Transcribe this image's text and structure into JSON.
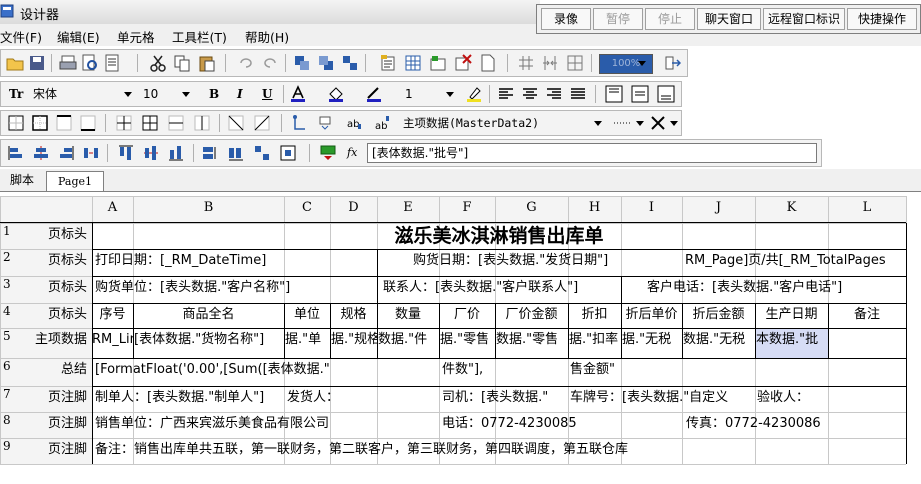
{
  "window": {
    "title": "设计器"
  },
  "menu": [
    "文件(F)",
    "编辑(E)",
    "单元格",
    "工具栏(T)",
    "帮助(H)"
  ],
  "float_toolbar": [
    {
      "label": "录像",
      "enabled": true
    },
    {
      "label": "暂停",
      "enabled": false
    },
    {
      "label": "停止",
      "enabled": false
    },
    {
      "label": "聊天窗口",
      "enabled": true
    },
    {
      "label": "远程窗口标识",
      "enabled": true
    },
    {
      "label": "快捷操作",
      "enabled": true
    }
  ],
  "format_bar": {
    "font_name": "宋体",
    "font_size": "10",
    "bold": "B",
    "italic": "I",
    "underline": "U",
    "line_width": "1",
    "zoom": "100%"
  },
  "datasource": "主项数据(MasterData2)",
  "formula": {
    "fx": "fx",
    "value": "[表体数据.\"批号\"]"
  },
  "tabs": {
    "script": "脚本",
    "page": "Page1"
  },
  "grid": {
    "columns": [
      "A",
      "B",
      "C",
      "D",
      "E",
      "F",
      "G",
      "H",
      "I",
      "J",
      "K",
      "L"
    ],
    "rows": [
      {
        "num": "1",
        "band": "页标头"
      },
      {
        "num": "2",
        "band": "页标头"
      },
      {
        "num": "3",
        "band": "页标头"
      },
      {
        "num": "4",
        "band": "页标头"
      },
      {
        "num": "5",
        "band": "主项数据"
      },
      {
        "num": "6",
        "band": "总结"
      },
      {
        "num": "7",
        "band": "页注脚"
      },
      {
        "num": "8",
        "band": "页注脚"
      },
      {
        "num": "9",
        "band": "页注脚"
      }
    ],
    "title": "滋乐美冰淇淋销售出库单",
    "r2": {
      "print_date": "打印日期：[_RM_DateTime]",
      "purchase_date": "购货日期：[表头数据.\"发货日期\"]",
      "page": "RM_Page]页/共[_RM_TotalPages"
    },
    "r3": {
      "unit": "购货单位：[表头数据.\"客户名称\"]",
      "contact": "联系人：[表头数据.\"客户联系人\"]",
      "phone": "客户电话：[表头数据.\"客户电话\"]"
    },
    "r4": [
      "序号",
      "商品全名",
      "单位",
      "规格",
      "数量",
      "厂价",
      "厂价金额",
      "折扣",
      "折后单价",
      "折后金额",
      "生产日期",
      "备注"
    ],
    "r5": [
      "RM_Lin",
      "[表体数据.\"货物名称\"]",
      "据.\"单",
      "据.\"规格",
      "数据.\"件",
      "据.\"零售",
      "数据.\"零售",
      "据.\"扣率",
      "据.\"无税",
      "数据.\"无税",
      "本数据.\"批",
      ""
    ],
    "r6": {
      "sum1": "[FormatFloat('0.00',[Sum([表体数据.\"",
      "sum2": "件数\"],",
      "sum3": "售金额\""
    },
    "r7": {
      "maker": "制单人：[表头数据.\"制单人\"]",
      "shipper": "发货人：",
      "driver": "司机：[表头数据.\"",
      "plate": "车牌号：[表头数据.\"自定义",
      "receiver": "验收人："
    },
    "r8": {
      "seller": "销售单位：广西来宾滋乐美食品有限公司",
      "tel": "电话：0772-4230085",
      "fax": "传真：0772-4230086"
    },
    "r9": {
      "note": "备注：销售出库单共五联，第一联财务，第二联客户，第三联财务，第四联调度，第五联仓库"
    }
  }
}
